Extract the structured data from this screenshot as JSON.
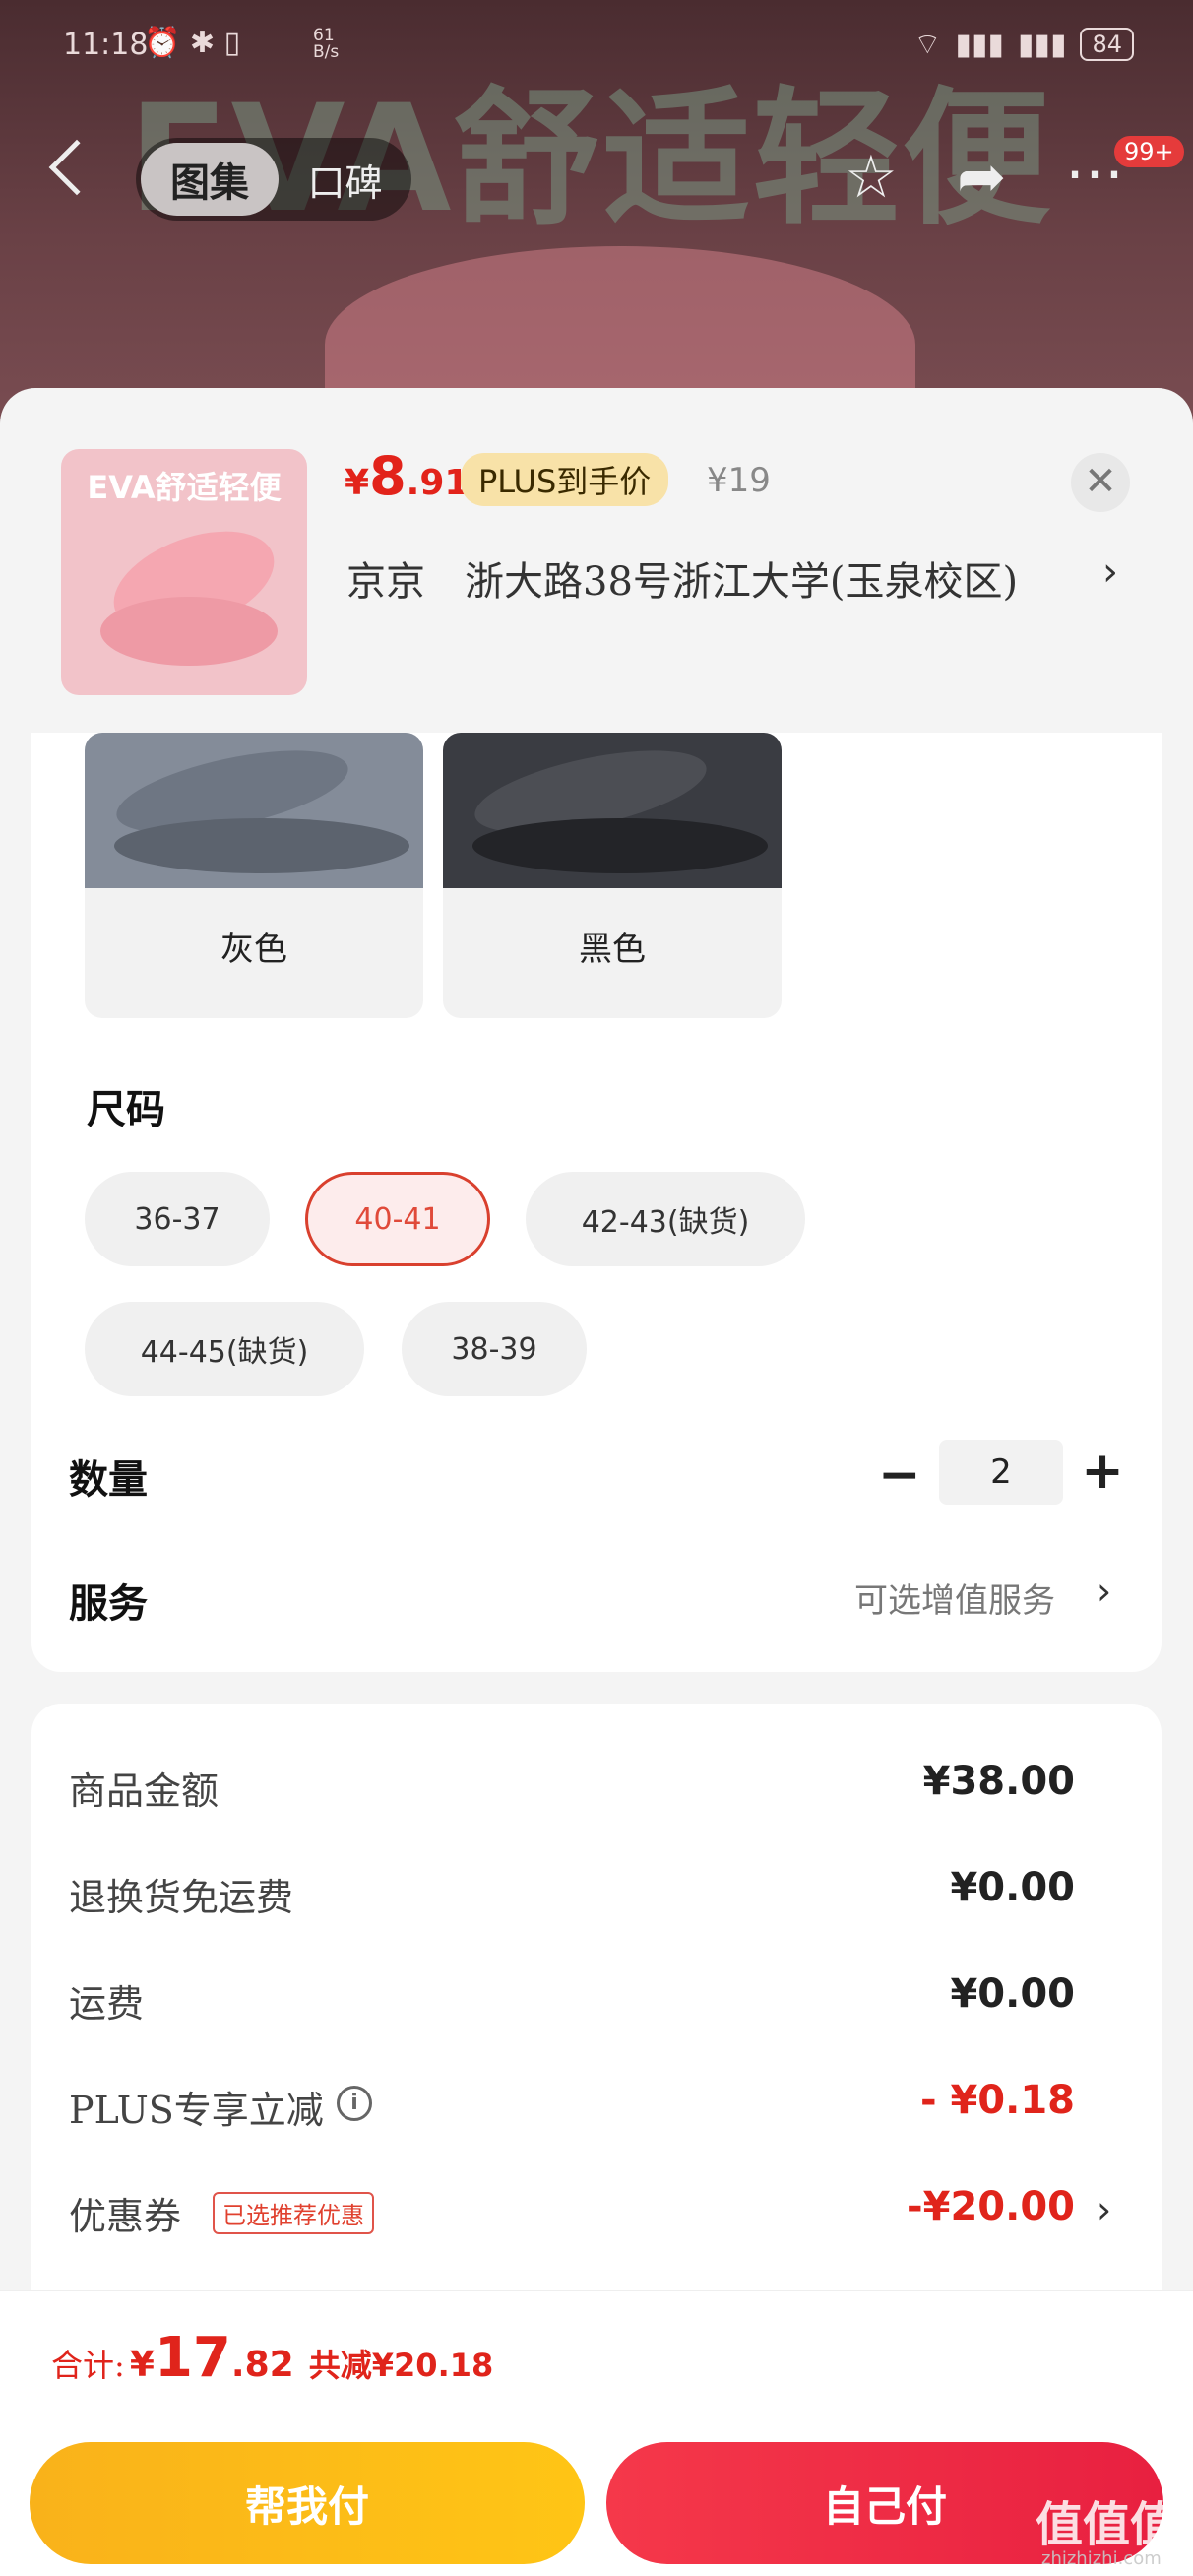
{
  "status_bar": {
    "time": "11:18",
    "speed_value": "61",
    "speed_unit": "B/s",
    "battery": "84"
  },
  "top": {
    "banner_text": "EVA舒适轻便",
    "tab_gallery": "图集",
    "tab_reviews": "口碑",
    "badge": "99+"
  },
  "product": {
    "thumb_caption": "EVA舒适轻便",
    "price_currency": "¥",
    "price_int": "8",
    "price_dec": ".91",
    "plus_tag": "PLUS到手价",
    "original_price": "¥19",
    "address": "京京　浙大路38号浙江大学(玉泉校区)"
  },
  "colors": [
    {
      "name": "灰色"
    },
    {
      "name": "黑色"
    }
  ],
  "size_section": {
    "title": "尺码"
  },
  "sizes": [
    {
      "label": "36-37"
    },
    {
      "label": "40-41",
      "selected": true
    },
    {
      "label": "42-43(缺货)"
    },
    {
      "label": "44-45(缺货)"
    },
    {
      "label": "38-39"
    }
  ],
  "quantity": {
    "label": "数量",
    "value": "2",
    "minus": "−",
    "plus": "+"
  },
  "service": {
    "label": "服务",
    "value": "可选增值服务"
  },
  "summary": [
    {
      "label": "商品金额",
      "value": "¥38.00"
    },
    {
      "label": "退换货免运费",
      "value": "¥0.00"
    },
    {
      "label": "运费",
      "value": "¥0.00"
    },
    {
      "label": "PLUS专享立减",
      "value": "- ¥0.18"
    },
    {
      "label": "优惠券",
      "tag": "已选推荐优惠",
      "value": "-¥20.00"
    }
  ],
  "footer": {
    "total_label": "合计:",
    "total_currency": "¥",
    "total_int": "17",
    "total_dec": ".82",
    "saved": "共减¥20.18",
    "help_pay": "帮我付",
    "self_pay": "自己付"
  },
  "watermark": {
    "logo": "值值值",
    "url": "zhizhizhi.com"
  },
  "colors_theme": {
    "accent_red": "#e2231a",
    "plus_gold": "#f8e2a8",
    "help_btn": "#fbb81a",
    "self_btn": "#ee2c45"
  }
}
